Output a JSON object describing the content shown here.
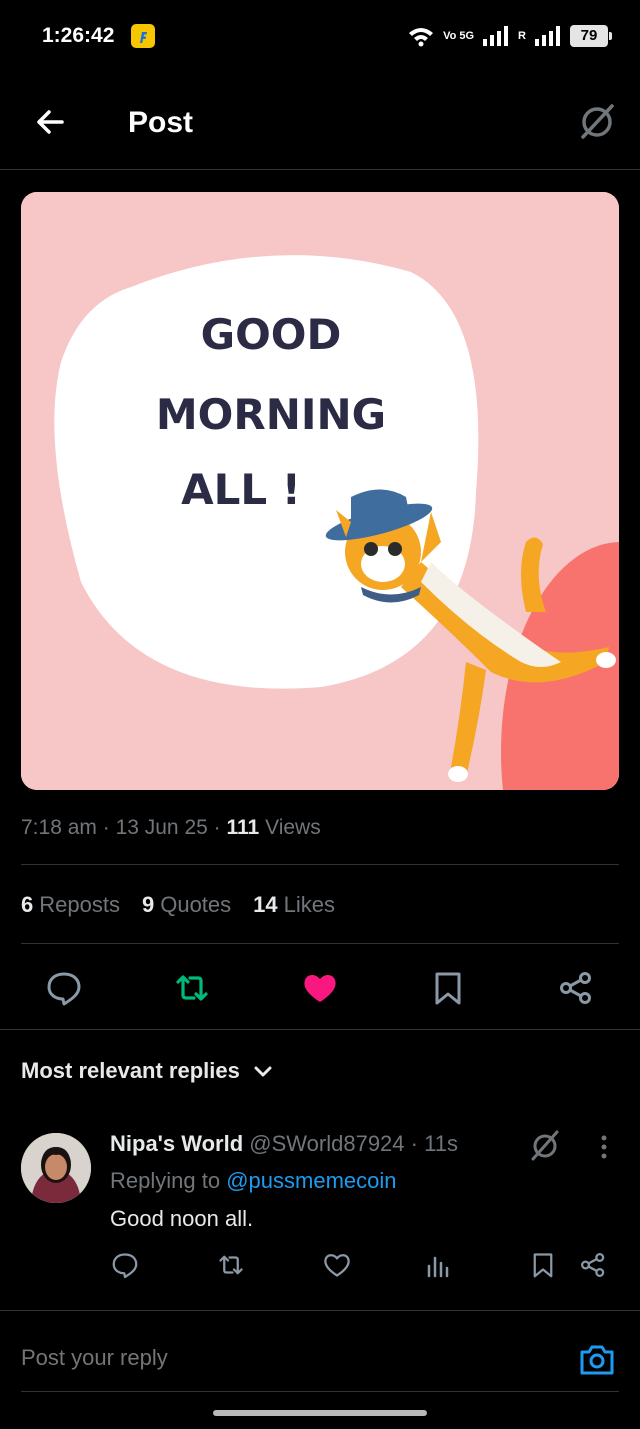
{
  "status_bar": {
    "time": "1:26:42",
    "network_primary": "Vo 5G",
    "network_secondary": "R",
    "battery": "79"
  },
  "header": {
    "title": "Post",
    "back_icon": "arrow-left-icon",
    "grok_icon": "grok-icon"
  },
  "post": {
    "image_text": [
      "GOOD",
      "MORNING",
      "ALL !"
    ],
    "time": "7:18 am",
    "date": "13 Jun 25",
    "views_count": "111",
    "views_label": "Views",
    "stats": {
      "reposts_count": "6",
      "reposts_label": "Reposts",
      "quotes_count": "9",
      "quotes_label": "Quotes",
      "likes_count": "14",
      "likes_label": "Likes"
    },
    "actions": [
      "reply-icon",
      "repost-icon",
      "like-icon",
      "bookmark-icon",
      "share-icon"
    ],
    "colors": {
      "repost_active": "#00ba7c",
      "like_active": "#f91880",
      "mention": "#1d9bf0"
    }
  },
  "replies": {
    "sort_label": "Most relevant replies",
    "items": [
      {
        "name": "Nipa's World",
        "handle": "@SWorld87924",
        "time": "11s",
        "replying_label": "Replying to",
        "replying_to": "@pussmemecoin",
        "text": "Good noon all."
      }
    ]
  },
  "compose": {
    "placeholder": "Post your reply",
    "camera_icon": "camera-icon"
  }
}
